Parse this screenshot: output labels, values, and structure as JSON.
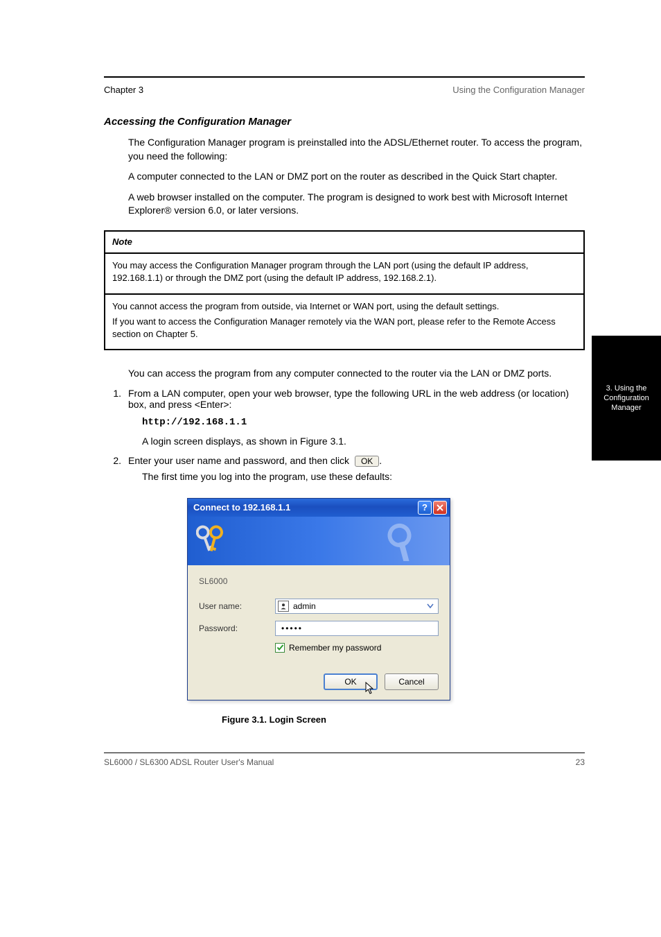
{
  "header": {
    "left": "Chapter 3",
    "right": "Using the Configuration Manager"
  },
  "section_title": "Accessing the Configuration Manager",
  "intro": "The Configuration Manager program is preinstalled into the ADSL/Ethernet router. To access the program, you need the following:",
  "bullets": [
    "A computer connected to the LAN or DMZ port on the router as described in the Quick Start chapter.",
    "A web browser installed on the computer. The program is designed to work best with Microsoft Internet Explorer® version 6.0, or later versions."
  ],
  "note": {
    "title": "Note",
    "p1": "You may access the Configuration Manager program through the LAN port (using the default IP address, 192.168.1.1) or through the DMZ port (using the default IP address, 192.168.2.1).",
    "p2": "You cannot access the program from outside, via Internet or WAN port, using the default settings.",
    "p3": "If you want to access the Configuration Manager remotely via the WAN port, please refer to the Remote Access section on Chapter 5.",
    "row_separator": true
  },
  "steps_para": "You can access the program from any computer connected to the router via the LAN or DMZ ports.",
  "steps": [
    {
      "num": "1.",
      "body": "From a LAN computer, open your web browser, type the following URL in the web address (or location) box, and press",
      "tail": "<Enter>:"
    },
    {
      "num": "",
      "body_url": "http://192.168.1.1"
    },
    {
      "num": "",
      "body": "A login screen displays, as shown in Figure 3.1."
    },
    {
      "num": "2.",
      "body": "Enter your user name and password, and then click",
      "tail_btn": "OK"
    }
  ],
  "first_time": "The first time you log into the program, use these defaults:",
  "dialog": {
    "title": "Connect to 192.168.1.1",
    "realm": "SL6000",
    "username_label": "User name:",
    "username_value": "admin",
    "password_label": "Password:",
    "password_value": "•••••",
    "remember_label": "Remember my password",
    "ok_label": "OK",
    "cancel_label": "Cancel"
  },
  "caption": "Figure 3.1. Login Screen",
  "sidetab": "3. Using the Configuration Manager",
  "footer": {
    "left": "SL6000 / SL6300 ADSL Router User's Manual",
    "right": "23"
  }
}
